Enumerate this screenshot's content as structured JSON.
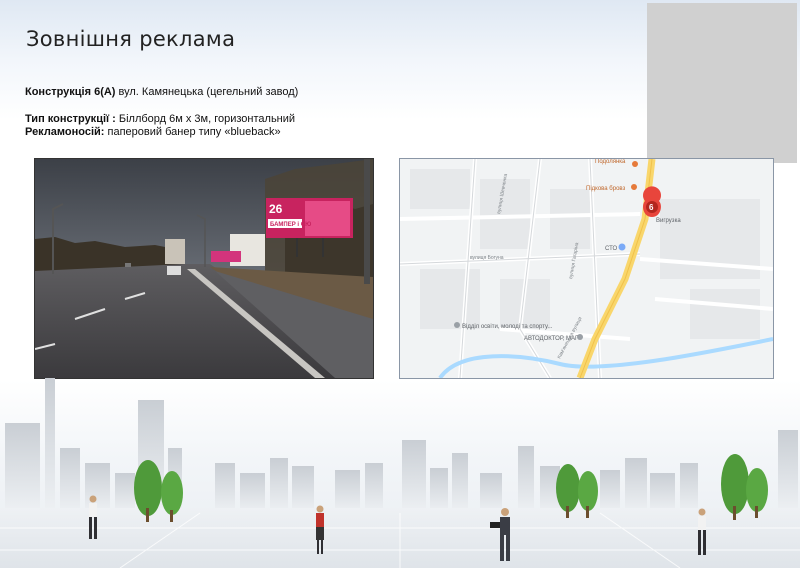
{
  "header": {
    "title": "Зовнішня реклама"
  },
  "construction": {
    "label": "Конструкція 6(А)",
    "address": " вул. Камянецька (цегельний завод)"
  },
  "type": {
    "label": "Тип конструкції :",
    "value": " Біллборд 6м х 3м, горизонтальний"
  },
  "carrier": {
    "label": "Рекламоносій:",
    "value": " паперовий банер типу «blueback»"
  },
  "billboard": {
    "number": "26",
    "brand": "БАМПЕР і СЮ"
  },
  "map": {
    "marker_number": "6",
    "labels": [
      "Подолянка",
      "Підкова бровз",
      "Вигрузка",
      "СТО",
      "Відділ освіти, молоді та спорту...",
      "АВТОДОКТОР, МАГ"
    ],
    "streets": [
      "Кам'янецька вулиця",
      "вулиця Гагаріна",
      "вулиця Шевченка",
      "вулиця Лесі Українки",
      "вулиця Богуна"
    ]
  },
  "colors": {
    "map_marker": "#e8453c",
    "main_road": "#f9d66b",
    "water": "#aadaff"
  }
}
